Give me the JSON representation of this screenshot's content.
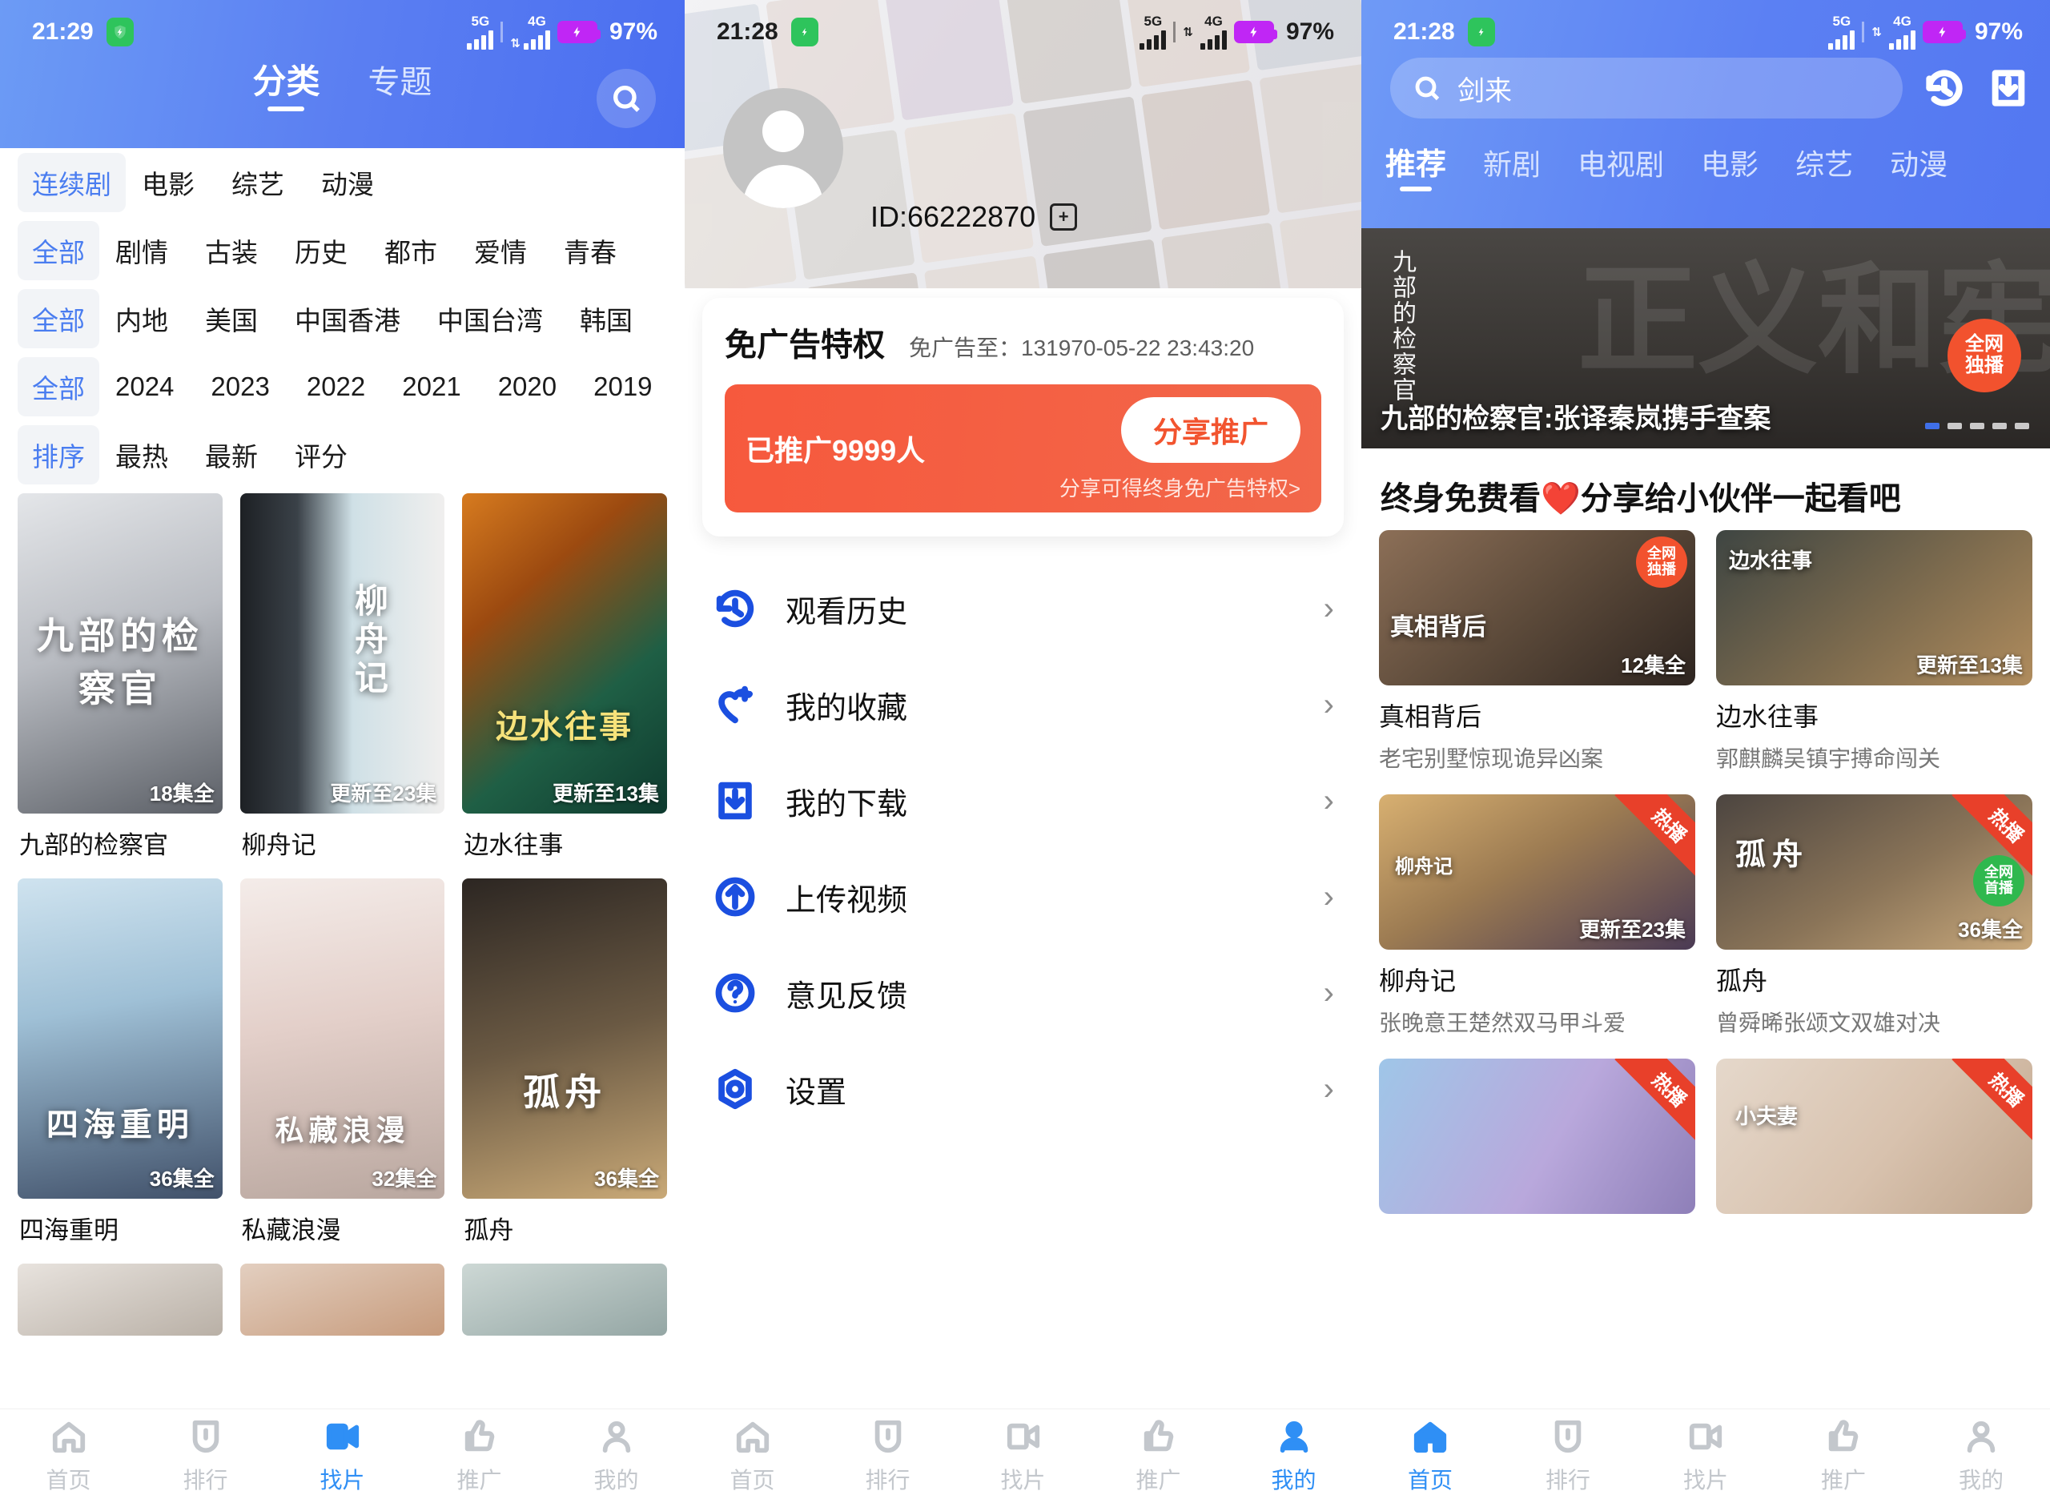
{
  "statusbars": {
    "p1": {
      "time": "21:29",
      "battery": "97%",
      "net1": "5G",
      "net2": "4G"
    },
    "p2": {
      "time": "21:28",
      "battery": "97%",
      "net1": "5G",
      "net2": "4G"
    },
    "p3": {
      "time": "21:28",
      "battery": "97%",
      "net1": "5G",
      "net2": "4G"
    }
  },
  "colors": {
    "header_blue": "#5b80f3",
    "accent_blue": "#2f8ff5",
    "chip_blue": "#4a7df0",
    "promo_red": "#f2542f",
    "hot_red": "#e8402a",
    "green_badge": "#2fb84e",
    "shield_green": "#2ec45c",
    "battery_purple": "#c026f5"
  },
  "panel1": {
    "tabs": [
      {
        "label": "分类",
        "active": true
      },
      {
        "label": "专题",
        "active": false
      }
    ],
    "search_icon": "search-icon",
    "filters": [
      {
        "chip": "连续剧",
        "items": [
          "电影",
          "综艺",
          "动漫"
        ]
      },
      {
        "chip": "全部",
        "items": [
          "剧情",
          "古装",
          "历史",
          "都市",
          "爱情",
          "青春"
        ]
      },
      {
        "chip": "全部",
        "items": [
          "内地",
          "美国",
          "中国香港",
          "中国台湾",
          "韩国"
        ]
      },
      {
        "chip": "全部",
        "items": [
          "2024",
          "2023",
          "2022",
          "2021",
          "2020",
          "2019"
        ]
      },
      {
        "chip": "排序",
        "items": [
          "最热",
          "最新",
          "评分"
        ]
      }
    ],
    "items": [
      {
        "title": "九部的检察官",
        "badge": "18集全",
        "poster_text": "九部的检察官",
        "style": "office"
      },
      {
        "title": "柳舟记",
        "badge": "更新至23集",
        "poster_text": "柳舟记",
        "style": "costume"
      },
      {
        "title": "边水往事",
        "badge": "更新至13集",
        "poster_text": "边水往事",
        "style": "tropic"
      },
      {
        "title": "四海重明",
        "badge": "36集全",
        "poster_text": "四海重明",
        "style": "fantasy"
      },
      {
        "title": "私藏浪漫",
        "badge": "32集全",
        "poster_text": "私藏浪漫",
        "style": "romance"
      },
      {
        "title": "孤舟",
        "badge": "36集全",
        "poster_text": "孤舟",
        "style": "noir"
      }
    ],
    "tabbar": [
      {
        "label": "首页",
        "icon": "home-icon",
        "active": false
      },
      {
        "label": "排行",
        "icon": "rank-icon",
        "active": false
      },
      {
        "label": "找片",
        "icon": "video-icon",
        "active": true
      },
      {
        "label": "推广",
        "icon": "thumbsup-icon",
        "active": false
      },
      {
        "label": "我的",
        "icon": "person-icon",
        "active": false
      }
    ]
  },
  "panel2": {
    "user_id": "ID:66222870",
    "copy_icon": "copy-icon",
    "avatar_icon": "avatar-icon",
    "ad": {
      "title": "免广告特权",
      "expire_label": "免广告至：",
      "expire_value": "131970-05-22 23:43:20",
      "promoted": "已推广9999人",
      "button": "分享推广",
      "sub": "分享可得终身免广告特权>"
    },
    "menu": [
      {
        "label": "观看历史",
        "icon": "history-icon"
      },
      {
        "label": "我的收藏",
        "icon": "heart-plus-icon"
      },
      {
        "label": "我的下载",
        "icon": "download-icon"
      },
      {
        "label": "上传视频",
        "icon": "upload-icon"
      },
      {
        "label": "意见反馈",
        "icon": "question-icon"
      },
      {
        "label": "设置",
        "icon": "gear-icon"
      }
    ],
    "chevron": "›",
    "tabbar": [
      {
        "label": "首页",
        "icon": "home-icon",
        "active": false
      },
      {
        "label": "排行",
        "icon": "rank-icon",
        "active": false
      },
      {
        "label": "找片",
        "icon": "video-icon",
        "active": false
      },
      {
        "label": "推广",
        "icon": "thumbsup-icon",
        "active": false
      },
      {
        "label": "我的",
        "icon": "person-icon",
        "active": true
      }
    ]
  },
  "panel3": {
    "search": {
      "value": "剑来",
      "icon": "search-icon"
    },
    "header_icons": [
      {
        "name": "history-icon"
      },
      {
        "name": "download-icon"
      }
    ],
    "nav_tabs": [
      {
        "label": "推荐",
        "active": true
      },
      {
        "label": "新剧",
        "active": false
      },
      {
        "label": "电视剧",
        "active": false
      },
      {
        "label": "电影",
        "active": false
      },
      {
        "label": "综艺",
        "active": false
      },
      {
        "label": "动漫",
        "active": false
      }
    ],
    "hero": {
      "caption": "九部的检察官:张译秦岚携手查案",
      "logo": "九部的检察官",
      "bg_text": "正义和宪",
      "badge_line1": "全网",
      "badge_line2": "独播",
      "dots": 5,
      "active_dot": 0
    },
    "section_title": "终身免费看❤️分享给小伙伴一起看吧",
    "items": [
      {
        "title": "真相背后",
        "sub": "老宅别墅惊现诡异凶案",
        "ep": "12集全",
        "corner": "",
        "round_badge": [
          "全网",
          "独播"
        ],
        "thumb_title": "真相背后",
        "style": "crime"
      },
      {
        "title": "边水往事",
        "sub": "郭麒麟吴镇宇搏命闯关",
        "ep": "更新至13集",
        "corner": "",
        "round_badge": [],
        "thumb_title": "边水往事",
        "style": "tropic"
      },
      {
        "title": "柳舟记",
        "sub": "张晚意王楚然双马甲斗爱",
        "ep": "更新至23集",
        "corner": "热播",
        "round_badge": [],
        "thumb_title": "柳舟记",
        "style": "costume"
      },
      {
        "title": "孤舟",
        "sub": "曾舜晞张颂文双雄对决",
        "ep": "36集全",
        "corner": "热播",
        "round_badge": [
          "全网",
          "首播"
        ],
        "thumb_title": "孤舟",
        "style": "noir"
      },
      {
        "title": "",
        "sub": "",
        "ep": "",
        "corner": "热播",
        "round_badge": [],
        "thumb_title": "",
        "style": "fantasy"
      },
      {
        "title": "",
        "sub": "",
        "ep": "",
        "corner": "热播",
        "round_badge": [],
        "thumb_title": "小夫妻",
        "style": "family"
      }
    ],
    "tabbar": [
      {
        "label": "首页",
        "icon": "home-icon",
        "active": true
      },
      {
        "label": "排行",
        "icon": "rank-icon",
        "active": false
      },
      {
        "label": "找片",
        "icon": "video-icon",
        "active": false
      },
      {
        "label": "推广",
        "icon": "thumbsup-icon",
        "active": false
      },
      {
        "label": "我的",
        "icon": "person-icon",
        "active": false
      }
    ]
  }
}
